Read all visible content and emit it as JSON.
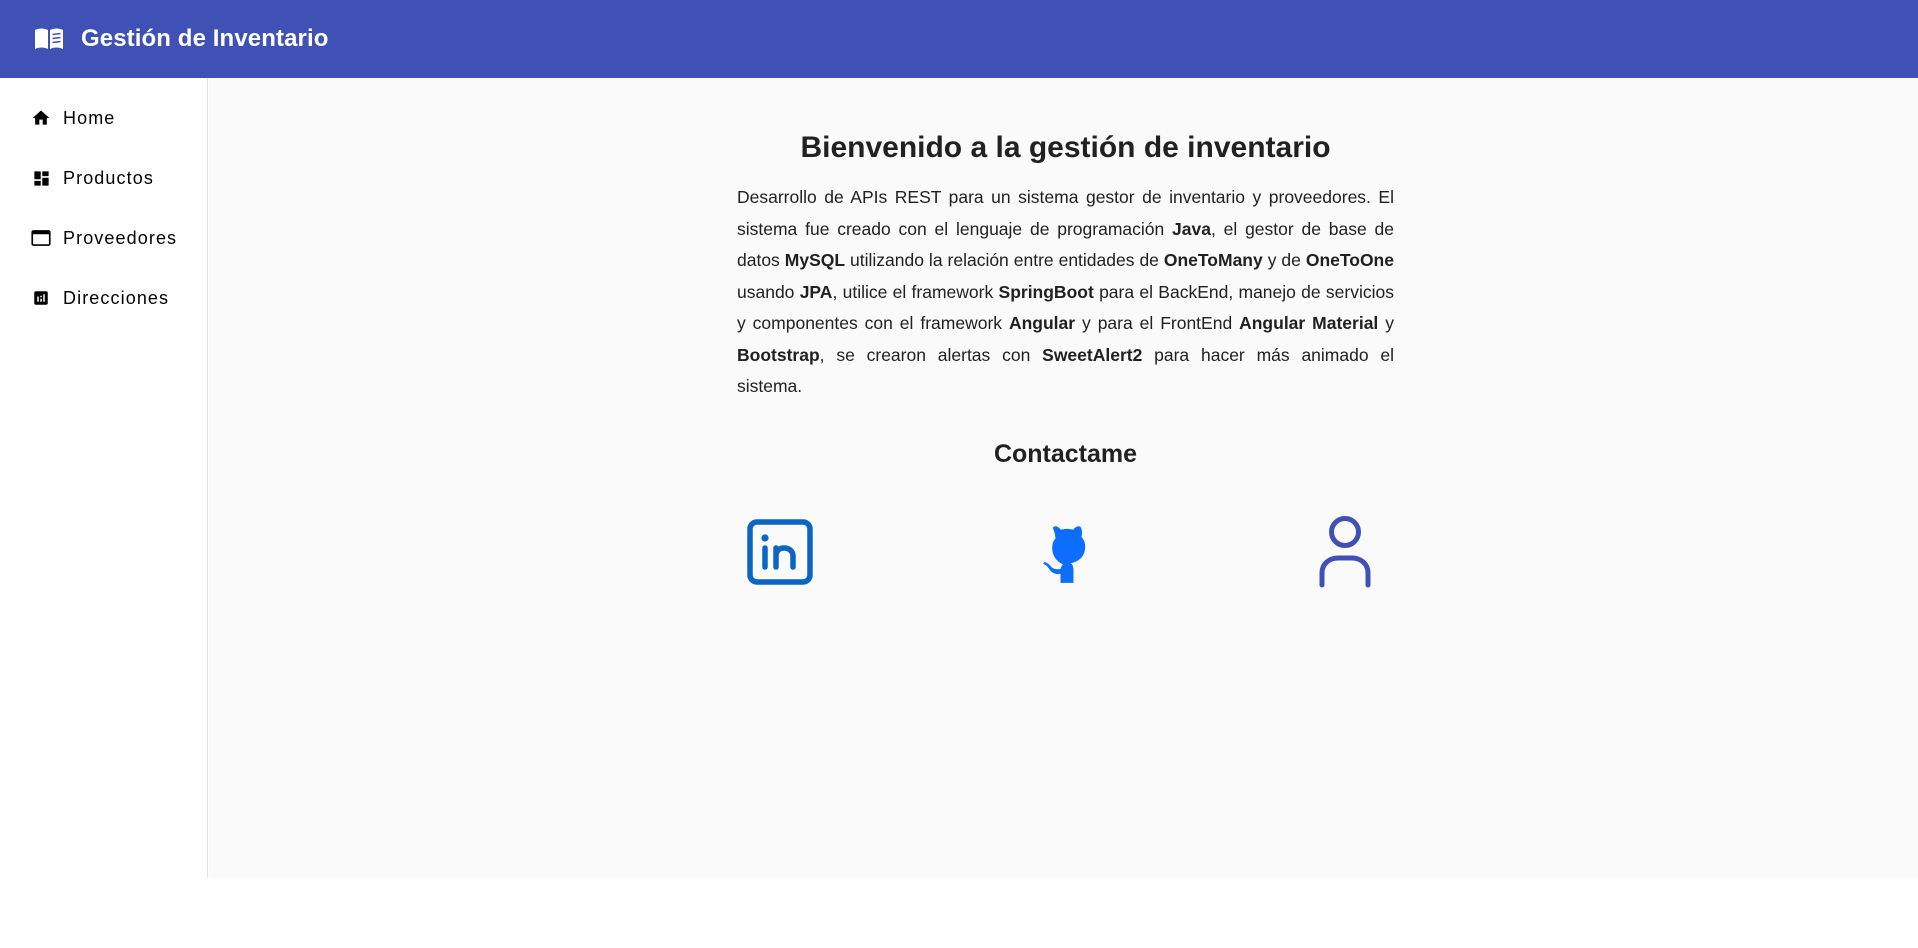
{
  "app": {
    "title": "Gestión de Inventario",
    "logo_icon": "book-open-icon",
    "header_color": "#3f51b5"
  },
  "sidebar": {
    "items": [
      {
        "label": "Home",
        "icon": "home-icon"
      },
      {
        "label": "Productos",
        "icon": "dashboard-icon"
      },
      {
        "label": "Proveedores",
        "icon": "web-asset-icon"
      },
      {
        "label": "Direcciones",
        "icon": "analytics-icon"
      }
    ]
  },
  "main": {
    "heading": "Bienvenido a la gestión de inventario",
    "description": [
      {
        "text": "Desarrollo de APIs REST para un sistema gestor de inventario y proveedores. El sistema fue creado con el lenguaje de programación ",
        "bold": false
      },
      {
        "text": "Java",
        "bold": true
      },
      {
        "text": ", el gestor de base de datos ",
        "bold": false
      },
      {
        "text": "MySQL",
        "bold": true
      },
      {
        "text": " utilizando la relación entre entidades de ",
        "bold": false
      },
      {
        "text": "OneToMany",
        "bold": true
      },
      {
        "text": " y de ",
        "bold": false
      },
      {
        "text": "OneToOne",
        "bold": true
      },
      {
        "text": " usando ",
        "bold": false
      },
      {
        "text": "JPA",
        "bold": true
      },
      {
        "text": ", utilice el framework ",
        "bold": false
      },
      {
        "text": "SpringBoot",
        "bold": true
      },
      {
        "text": " para el BackEnd, manejo de servicios y componentes con el framework ",
        "bold": false
      },
      {
        "text": "Angular",
        "bold": true
      },
      {
        "text": " y para el FrontEnd ",
        "bold": false
      },
      {
        "text": "Angular Material",
        "bold": true
      },
      {
        "text": " y ",
        "bold": false
      },
      {
        "text": "Bootstrap",
        "bold": true
      },
      {
        "text": ", se crearon alertas con ",
        "bold": false
      },
      {
        "text": "SweetAlert2",
        "bold": true
      },
      {
        "text": " para hacer más animado el sistema.",
        "bold": false
      }
    ],
    "contact_title": "Contactame",
    "contacts": [
      {
        "icon": "linkedin-icon",
        "color": "#0a66c2"
      },
      {
        "icon": "github-icon",
        "color": "#0d6efd"
      },
      {
        "icon": "user-icon",
        "color": "#3f51b5"
      }
    ]
  }
}
